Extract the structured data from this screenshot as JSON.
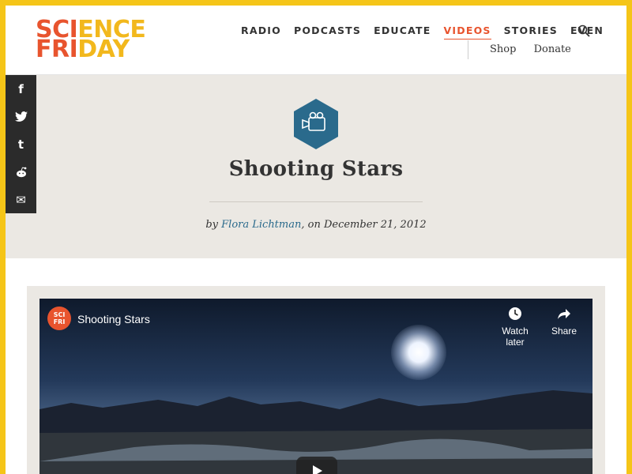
{
  "logo": {
    "line1_a": "SCI",
    "line1_b": "ENCE",
    "line2_a": "FRI",
    "line2_b": "DAY"
  },
  "nav": {
    "items": [
      "RADIO",
      "PODCASTS",
      "EDUCATE",
      "VIDEOS",
      "STORIES",
      "EVEN"
    ],
    "active": "VIDEOS"
  },
  "subnav": {
    "shop": "Shop",
    "donate": "Donate"
  },
  "share": {
    "facebook": "f",
    "twitter": "t",
    "tumblr": "t",
    "reddit": "r",
    "email": "✉"
  },
  "article": {
    "title": "Shooting Stars",
    "byline_prefix": "by",
    "author": "Flora Lichtman",
    "byline_suffix": ", on December 21, 2012"
  },
  "video": {
    "channel_logo_line1": "SCI",
    "channel_logo_line2": "FRI",
    "title": "Shooting Stars",
    "watch_later": "Watch later",
    "share": "Share"
  },
  "colors": {
    "accent": "#e8542e",
    "yellow": "#f5c518",
    "hex_blue": "#2a6a8c"
  }
}
